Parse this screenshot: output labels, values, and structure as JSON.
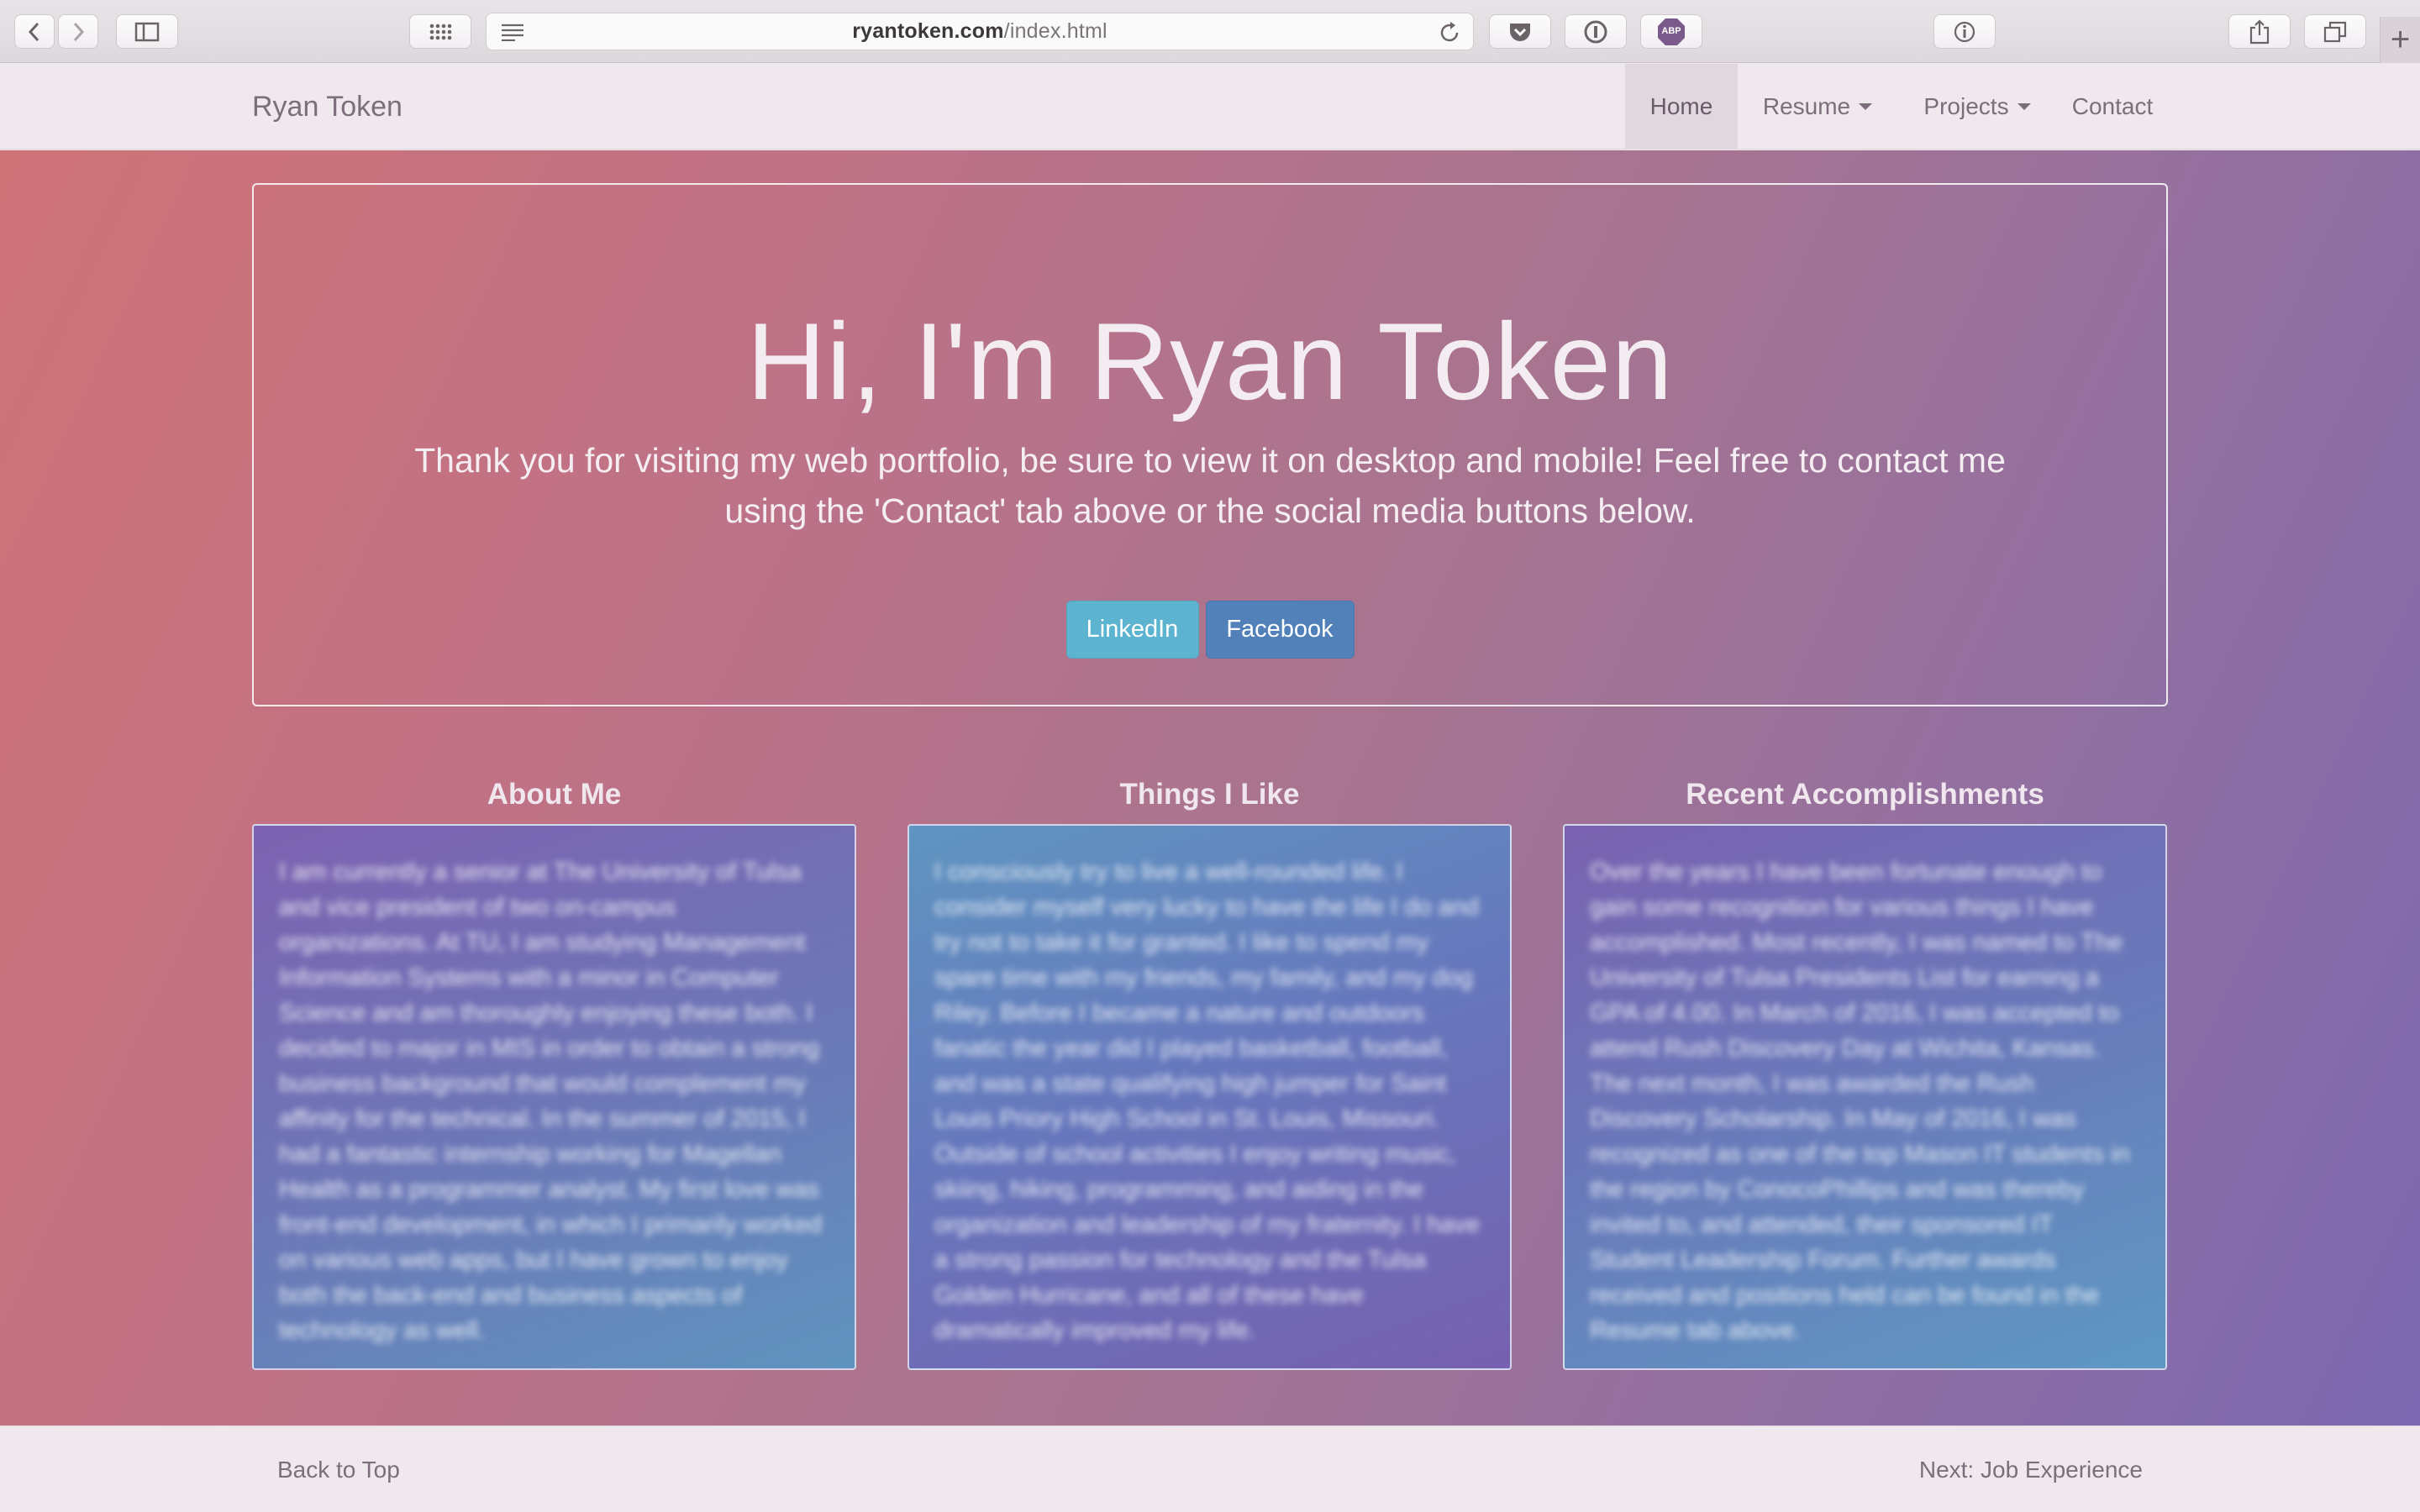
{
  "browser": {
    "url_host": "ryantoken.com",
    "url_path": "/index.html",
    "abp_label": "ABP"
  },
  "navbar": {
    "brand": "Ryan Token",
    "items": [
      {
        "label": "Home",
        "active": true,
        "dropdown": false
      },
      {
        "label": "Resume",
        "active": false,
        "dropdown": true
      },
      {
        "label": "Projects",
        "active": false,
        "dropdown": true
      },
      {
        "label": "Contact",
        "active": false,
        "dropdown": false
      }
    ]
  },
  "hero": {
    "title": "Hi, I'm Ryan Token",
    "subtitle": "Thank you for visiting my web portfolio, be sure to view it on desktop and mobile! Feel free to contact me using the 'Contact' tab above or the social media buttons below.",
    "linkedin_label": "LinkedIn",
    "facebook_label": "Facebook"
  },
  "sections": [
    {
      "title": "About Me",
      "body": "I am currently a senior at The University of Tulsa and vice president of two on-campus organizations. At TU, I am studying Management Information Systems with a minor in Computer Science and am thoroughly enjoying these both. I decided to major in MIS in order to obtain a strong business background that would complement my affinity for the technical. In the summer of 2015, I had a fantastic internship working for Magellan Health as a programmer analyst. My first love was front-end development, in which I primarily worked on various web apps, but I have grown to enjoy both the back-end and business aspects of technology as well."
    },
    {
      "title": "Things I Like",
      "body": "I consciously try to live a well-rounded life. I consider myself very lucky to have the life I do and try not to take it for granted. I like to spend my spare time with my friends, my family, and my dog Riley. Before I became a nature and outdoors fanatic the year did I played basketball, football, and was a state qualifying high jumper for Saint Louis Priory High School in St. Louis, Missouri. Outside of school activities I enjoy writing music, skiing, hiking, programming, and aiding in the organization and leadership of my fraternity. I have a strong passion for technology and the Tulsa Golden Hurricane, and all of these have dramatically improved my life."
    },
    {
      "title": "Recent Accomplishments",
      "body": "Over the years I have been fortunate enough to gain some recognition for various things I have accomplished. Most recently, I was named to The University of Tulsa Presidents List for earning a GPA of 4.00. In March of 2016, I was accepted to attend Rush Discovery Day at Wichita, Kansas. The next month, I was awarded the Rush Discovery Scholarship. In May of 2016, I was recognized as one of the top Mason IT students in the region by ConocoPhillips and was thereby invited to, and attended, their sponsored IT Student Leadership Forum. Further awards received and positions held can be found in the Resume tab above."
    }
  ],
  "footer": {
    "back_to_top": "Back to Top",
    "next": "Next: Job Experience"
  },
  "colors": {
    "linkedin": "#5cb4d1",
    "facebook": "#5181b8",
    "gradient_start": "#cf7378",
    "gradient_end": "#7b68b0"
  }
}
